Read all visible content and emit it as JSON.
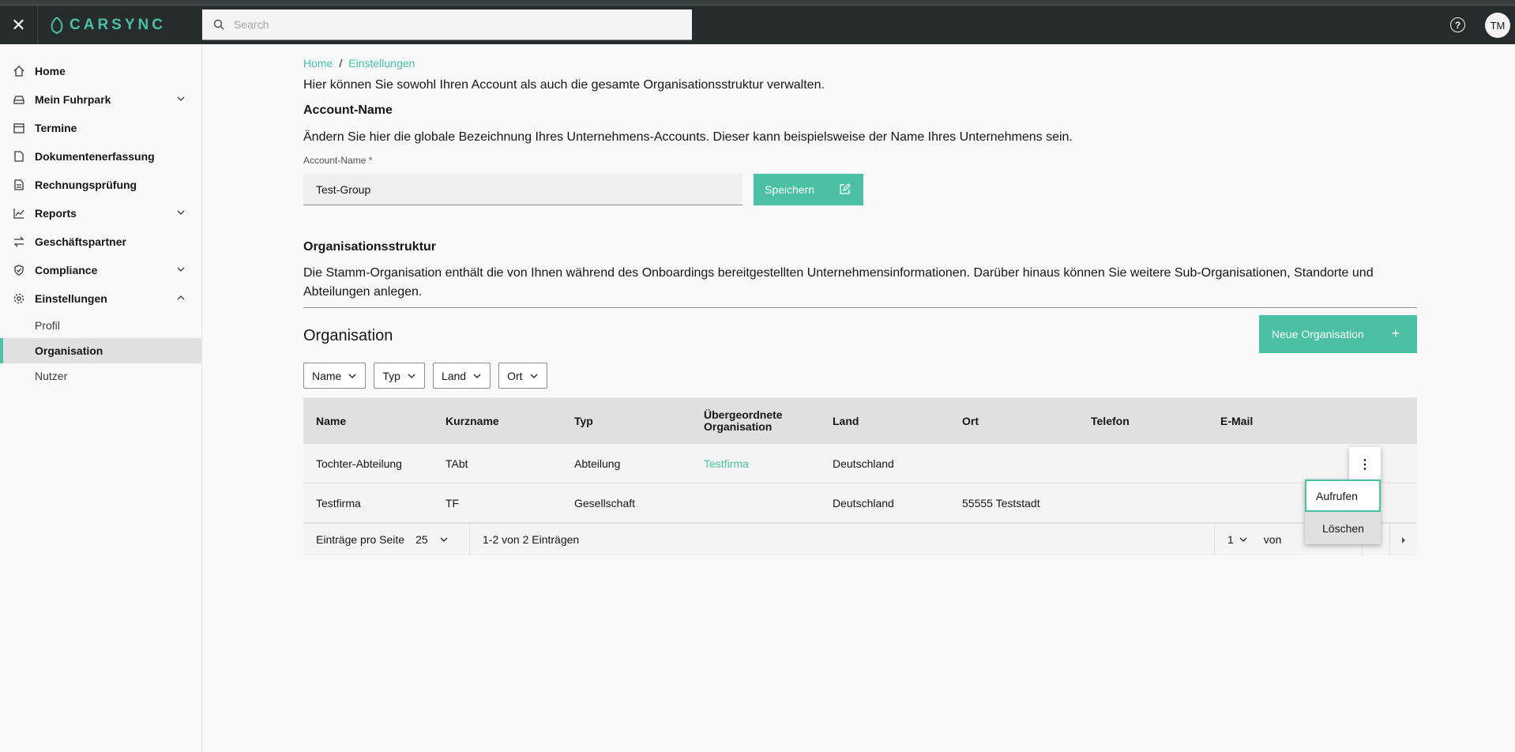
{
  "topbar": {
    "logo_text": "CARSYNC",
    "search_placeholder": "Search",
    "avatar_initials": "TM"
  },
  "sidebar": {
    "items": [
      {
        "label": "Home",
        "icon": "home-icon"
      },
      {
        "label": "Mein Fuhrpark",
        "icon": "car-icon"
      },
      {
        "label": "Termine",
        "icon": "calendar-icon"
      },
      {
        "label": "Dokumentenerfassung",
        "icon": "document-icon"
      },
      {
        "label": "Rechnungsprüfung",
        "icon": "invoice-icon"
      },
      {
        "label": "Reports",
        "icon": "chart-icon"
      },
      {
        "label": "Geschäftspartner",
        "icon": "swap-icon"
      },
      {
        "label": "Compliance",
        "icon": "shield-icon"
      },
      {
        "label": "Einstellungen",
        "icon": "gear-icon"
      }
    ],
    "subitems": [
      "Profil",
      "Organisation",
      "Nutzer"
    ]
  },
  "breadcrumb": {
    "home": "Home",
    "sep": "/",
    "current": "Einstellungen"
  },
  "intro": "Hier können Sie sowohl Ihren Account als auch die gesamte Organisationsstruktur verwalten.",
  "account": {
    "heading": "Account-Name",
    "description": "Ändern Sie hier die globale Bezeichnung Ihres Unternehmens-Accounts. Dieser kann beispielsweise der Name Ihres Unternehmens sein.",
    "field_label": "Account-Name *",
    "field_value": "Test-Group",
    "save_label": "Speichern"
  },
  "structure": {
    "heading": "Organisationsstruktur",
    "description": "Die Stamm-Organisation enthält die von Ihnen während des Onboardings bereitgestellten Unternehmensinformationen. Darüber hinaus können Sie weitere Sub-Organisationen, Standorte und Abteilungen anlegen."
  },
  "org": {
    "title": "Organisation",
    "new_button": "Neue Organisation",
    "filters": [
      "Name",
      "Typ",
      "Land",
      "Ort"
    ],
    "columns": [
      "Name",
      "Kurzname",
      "Typ",
      "Übergeordnete Organisation",
      "Land",
      "Ort",
      "Telefon",
      "E-Mail"
    ],
    "rows": [
      [
        "Tochter-Abteilung",
        "TAbt",
        "Abteilung",
        "Testfirma",
        "Deutschland",
        "",
        "",
        ""
      ],
      [
        "Testfirma",
        "TF",
        "Gesellschaft",
        "",
        "Deutschland",
        "55555 Teststadt",
        "",
        ""
      ]
    ],
    "pager": {
      "per_page_label": "Einträge pro Seite",
      "per_page_value": "25",
      "range": "1-2 von 2 Einträgen",
      "page": "1",
      "of_label": "von"
    },
    "menu": [
      "Aufrufen",
      "Löschen"
    ]
  }
}
